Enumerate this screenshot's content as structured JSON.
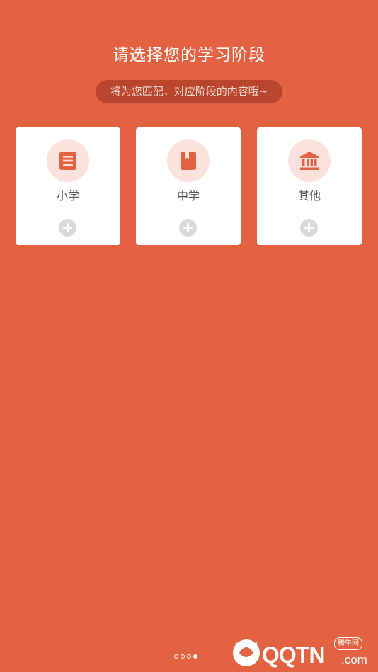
{
  "header": {
    "title": "请选择您的学习阶段",
    "subtitle": "将为您匹配，对应阶段的内容哦~"
  },
  "stages": [
    {
      "label": "小学",
      "icon": "document-list-icon"
    },
    {
      "label": "中学",
      "icon": "bookmark-book-icon"
    },
    {
      "label": "其他",
      "icon": "institution-building-icon"
    }
  ],
  "pager": {
    "total": 4,
    "current": 4
  },
  "watermark": {
    "brand": "QQTN",
    "suffix": ".com",
    "badge": "腾牛网"
  },
  "colors": {
    "background": "#e36242",
    "pill": "#b9452d",
    "card": "#ffffff",
    "icon_bg": "#fbe2dc",
    "icon_fg": "#e36242",
    "plus_bg": "#d9d9d9",
    "label": "#555555"
  }
}
